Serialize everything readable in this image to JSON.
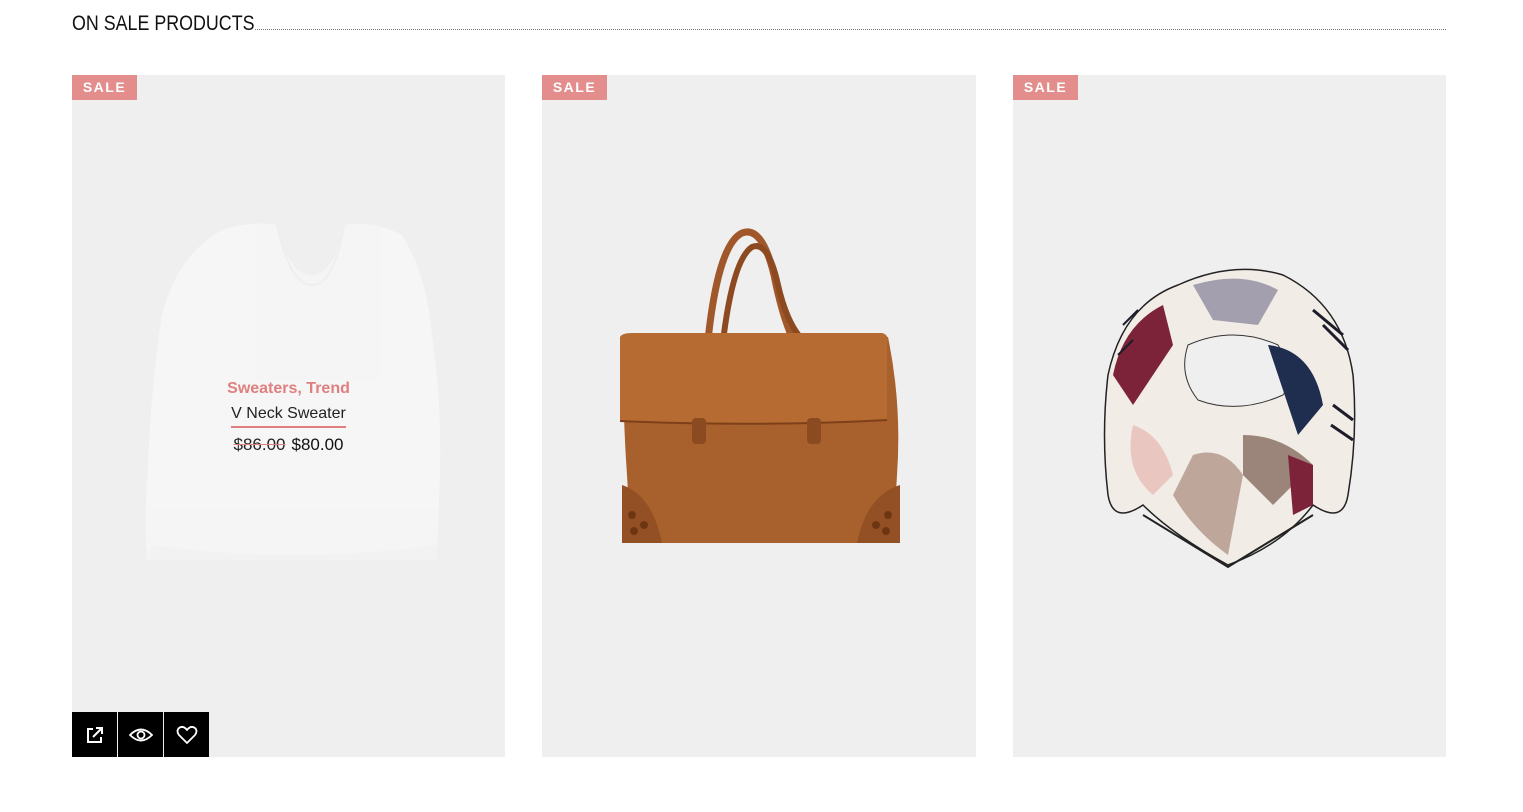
{
  "section": {
    "title": "ON SALE PRODUCTS"
  },
  "products": [
    {
      "badge": "SALE",
      "image": "white-sweater",
      "categories": "Sweaters, Trend",
      "name": "V Neck Sweater",
      "old_price": "$86.00",
      "price": "$80.00",
      "actions": [
        "external-link-icon",
        "eye-icon",
        "heart-icon"
      ]
    },
    {
      "badge": "SALE",
      "image": "brown-suede-bag"
    },
    {
      "badge": "SALE",
      "image": "printed-scarf"
    }
  ],
  "colors": {
    "badge": "#e38d8d",
    "accent": "#e07f7f",
    "card_bg": "#efefef",
    "action_bg": "#000000"
  }
}
